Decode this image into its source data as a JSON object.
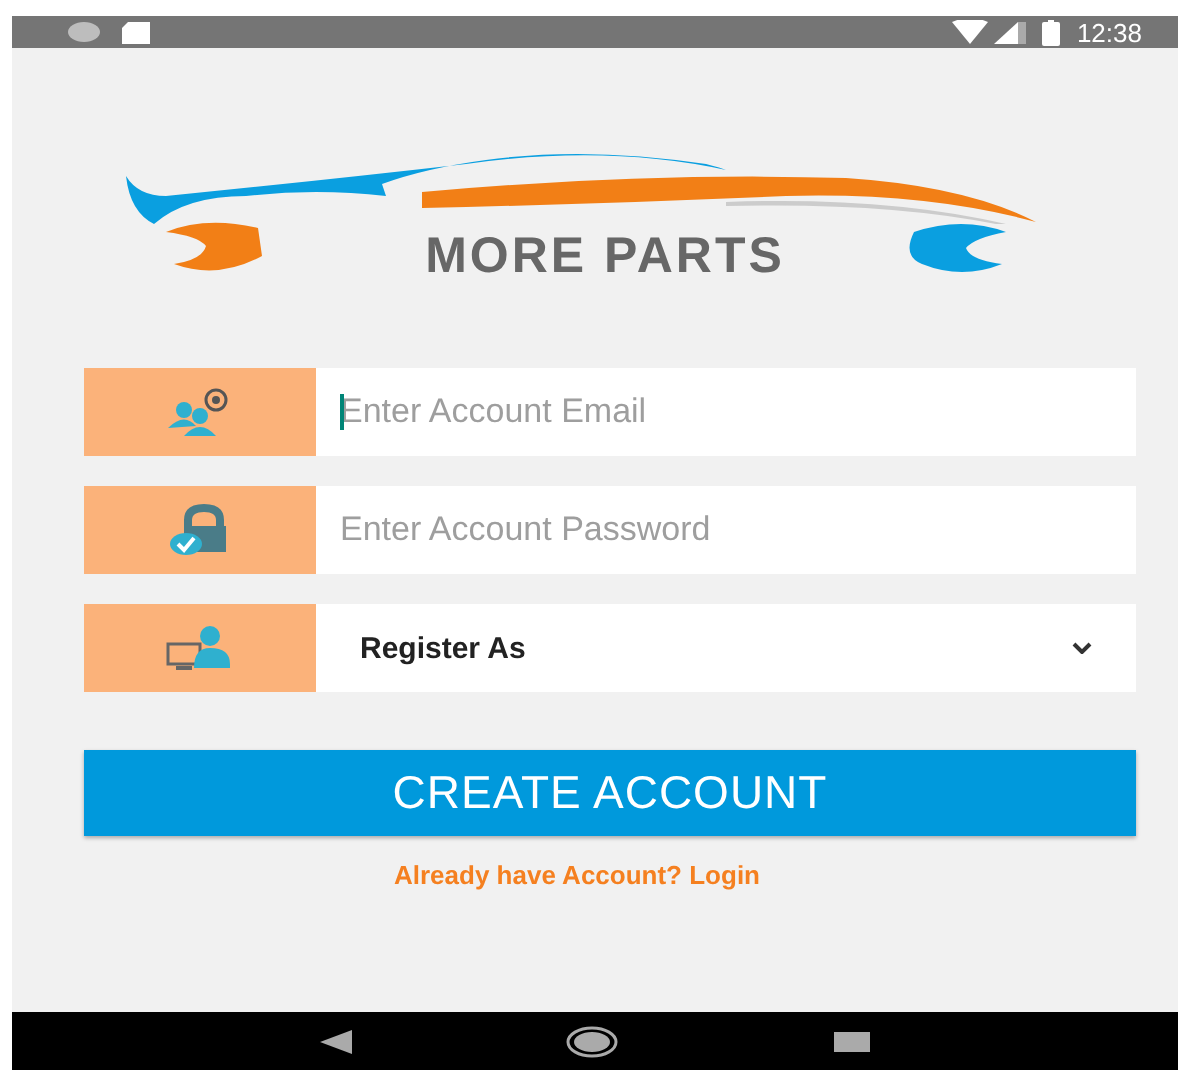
{
  "status_bar": {
    "time": "12:38"
  },
  "logo": {
    "name": "MORE PARTS"
  },
  "fields": [
    {
      "kind": "input",
      "placeholder": "Enter Account Email",
      "focused": true
    },
    {
      "kind": "input",
      "placeholder": "Enter Account Password",
      "focused": false
    },
    {
      "kind": "dropdown",
      "value": "Register As"
    }
  ],
  "create_button": {
    "label": "CREATE ACCOUNT"
  },
  "login_link": {
    "label": "Already have Account? Login"
  }
}
